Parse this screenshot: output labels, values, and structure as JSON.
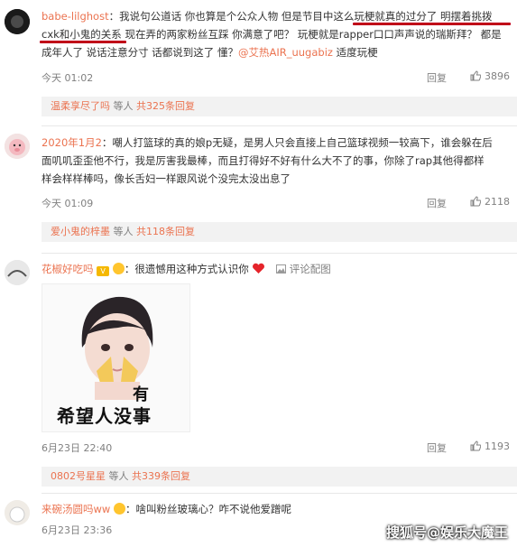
{
  "comments": [
    {
      "user": "babe-lilghost",
      "sep": "：",
      "text_a": "我说句公道话 你也算是个公众人物 但是节目中这么玩梗就真的过分了 明摆着挑拨",
      "text_b": "cxk和小鬼的关系 现在弄的两家粉丝互踩 你满意了吧？ 玩梗就是rapper口口声声说的瑞斯拜？ 都是",
      "text_c": "成年人了 说话注意分寸  话都说到这了 懂？",
      "mention": "@艾热AIR_uugabiz",
      "text_d": " 适度玩梗",
      "time": "今天 01:02",
      "reply": "回复",
      "likes": "3896",
      "sub_user": "温柔享尽了吗",
      "sub_text": " 等人 ",
      "sub_count": "共325条回复"
    },
    {
      "user": "2020年1月2",
      "sep": "：",
      "text_a": "嘲人打篮球的真的娘p无疑，是男人只会直接上自己篮球视频一较高下，谁会躲在后",
      "text_b": "面叽叽歪歪他不行，我是厉害我最棒，而且打得好不好有什么大不了的事，你除了rap其他得都样",
      "text_c": "样会样样棒吗，像长舌妇一样跟风说个没完太没出息了",
      "time": "今天 01:09",
      "reply": "回复",
      "likes": "2118",
      "sub_user": "爱小鬼的梓墨",
      "sub_text": " 等人 ",
      "sub_count": "共118条回复"
    },
    {
      "user": "花椒好吃吗",
      "sep": "：",
      "text_a": "很遗憾用这种方式认识你",
      "img_link": "评论配图",
      "meme_text": "希望人没事",
      "meme_top": "有",
      "time": "6月23日 22:40",
      "reply": "回复",
      "likes": "1193",
      "sub_user": "0802号星星",
      "sub_text": " 等人 ",
      "sub_count": "共339条回复"
    },
    {
      "user": "来碗汤圆吗ww",
      "sep": "：",
      "text_a": "啥叫粉丝玻璃心？咋不说他爱蹭呢",
      "time": "6月23日 23:36",
      "reply": "回复"
    }
  ],
  "watermark": "搜狐号@娱乐大魔王",
  "colors": {
    "accent": "#eb7350",
    "underline": "#c00018"
  }
}
